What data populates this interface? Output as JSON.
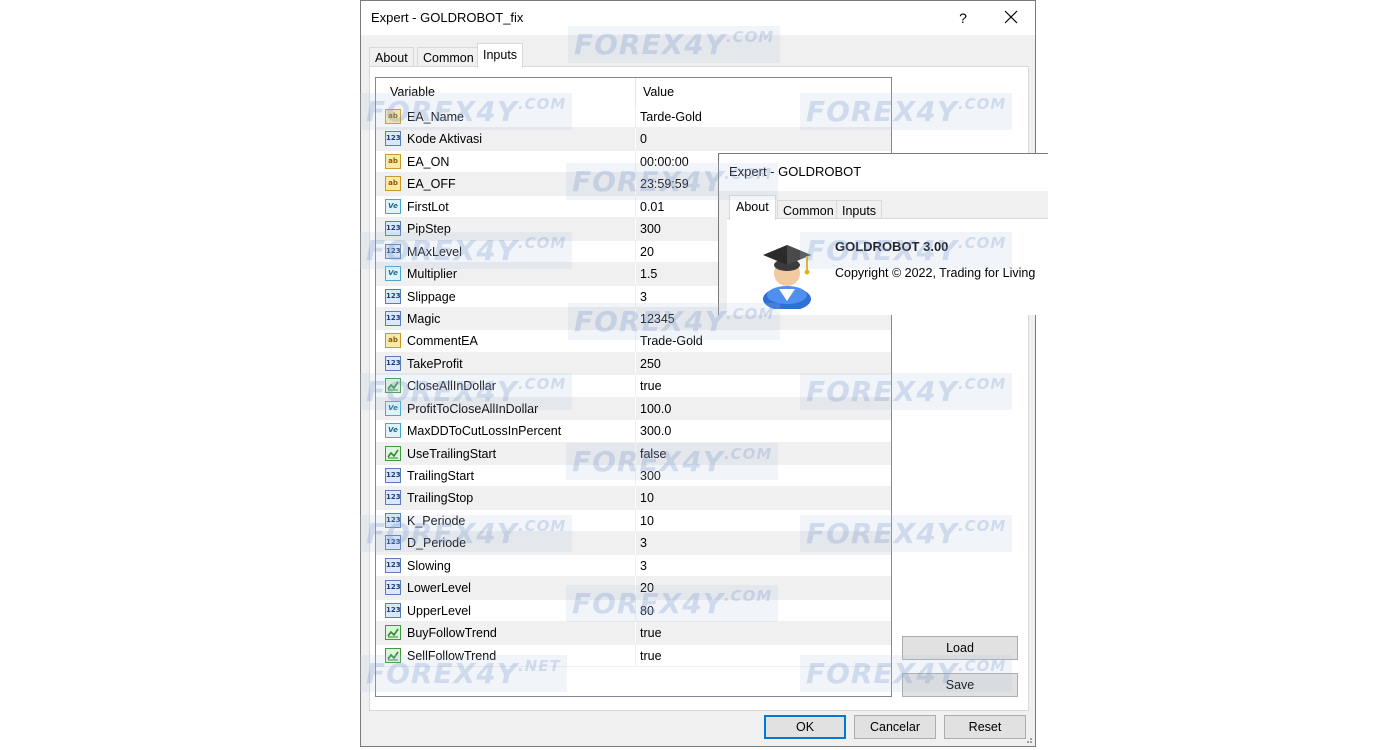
{
  "dialog": {
    "title": "Expert - GOLDROBOT_fix",
    "help_label": "?",
    "tabs": [
      {
        "label": "About"
      },
      {
        "label": "Common"
      },
      {
        "label": "Inputs"
      }
    ],
    "active_tab": "Inputs"
  },
  "table": {
    "headers": {
      "variable": "Variable",
      "value": "Value"
    },
    "rows": [
      {
        "type": "ab",
        "icon": "string-type-icon",
        "name": "EA_Name",
        "value": "Tarde-Gold"
      },
      {
        "type": "n123",
        "icon": "integer-type-icon",
        "name": "Kode Aktivasi",
        "value": "0"
      },
      {
        "type": "ab",
        "icon": "string-type-icon",
        "name": "EA_ON",
        "value": "00:00:00"
      },
      {
        "type": "ab",
        "icon": "string-type-icon",
        "name": "EA_OFF",
        "value": "23:59:59"
      },
      {
        "type": "ve",
        "icon": "double-type-icon",
        "name": "FirstLot",
        "value": "0.01"
      },
      {
        "type": "n123",
        "icon": "integer-type-icon",
        "name": "PipStep",
        "value": "300"
      },
      {
        "type": "n123",
        "icon": "integer-type-icon",
        "name": "MAxLevel",
        "value": "20"
      },
      {
        "type": "ve",
        "icon": "double-type-icon",
        "name": "Multiplier",
        "value": "1.5"
      },
      {
        "type": "n123",
        "icon": "integer-type-icon",
        "name": "Slippage",
        "value": "3"
      },
      {
        "type": "n123",
        "icon": "integer-type-icon",
        "name": "Magic",
        "value": "12345"
      },
      {
        "type": "ab",
        "icon": "string-type-icon",
        "name": "CommentEA",
        "value": "Trade-Gold"
      },
      {
        "type": "n123",
        "icon": "integer-type-icon",
        "name": "TakeProfit",
        "value": "250"
      },
      {
        "type": "bool",
        "icon": "boolean-type-icon",
        "name": "CloseAllInDollar",
        "value": "true"
      },
      {
        "type": "ve",
        "icon": "double-type-icon",
        "name": "ProfitToCloseAllInDollar",
        "value": "100.0"
      },
      {
        "type": "ve",
        "icon": "double-type-icon",
        "name": "MaxDDToCutLossInPercent",
        "value": "300.0"
      },
      {
        "type": "bool",
        "icon": "boolean-type-icon",
        "name": "UseTrailingStart",
        "value": "false"
      },
      {
        "type": "n123",
        "icon": "integer-type-icon",
        "name": "TrailingStart",
        "value": "300"
      },
      {
        "type": "n123",
        "icon": "integer-type-icon",
        "name": "TrailingStop",
        "value": "10"
      },
      {
        "type": "n123",
        "icon": "integer-type-icon",
        "name": "K_Periode",
        "value": "10"
      },
      {
        "type": "n123",
        "icon": "integer-type-icon",
        "name": "D_Periode",
        "value": "3"
      },
      {
        "type": "n123",
        "icon": "integer-type-icon",
        "name": "Slowing",
        "value": "3"
      },
      {
        "type": "n123",
        "icon": "integer-type-icon",
        "name": "LowerLevel",
        "value": "20"
      },
      {
        "type": "n123",
        "icon": "integer-type-icon",
        "name": "UpperLevel",
        "value": "80"
      },
      {
        "type": "bool",
        "icon": "boolean-type-icon",
        "name": "BuyFollowTrend",
        "value": "true"
      },
      {
        "type": "bool",
        "icon": "boolean-type-icon",
        "name": "SellFollowTrend",
        "value": "true"
      }
    ]
  },
  "side_buttons": {
    "load": "Load",
    "save": "Save"
  },
  "footer": {
    "ok": "OK",
    "cancel": "Cancelar",
    "reset": "Reset"
  },
  "overlay": {
    "title": "Expert - GOLDROBOT",
    "tabs": [
      {
        "label": "About"
      },
      {
        "label": "Common"
      },
      {
        "label": "Inputs"
      }
    ],
    "active_tab": "About",
    "product_name": "GOLDROBOT 3.00",
    "copyright": "Copyright © 2022, Trading for Living",
    "icon": "graduate-icon"
  },
  "watermark": {
    "main": "FOREX4Y",
    "sup": ".COM",
    "sub": ".NET"
  },
  "icon_labels": {
    "ab": "ab",
    "n123": "123",
    "ve": "Ve"
  },
  "colors": {
    "accent": "#0078d7",
    "window_bg": "#f0f0f0",
    "alt_row": "#f0f0f0"
  }
}
